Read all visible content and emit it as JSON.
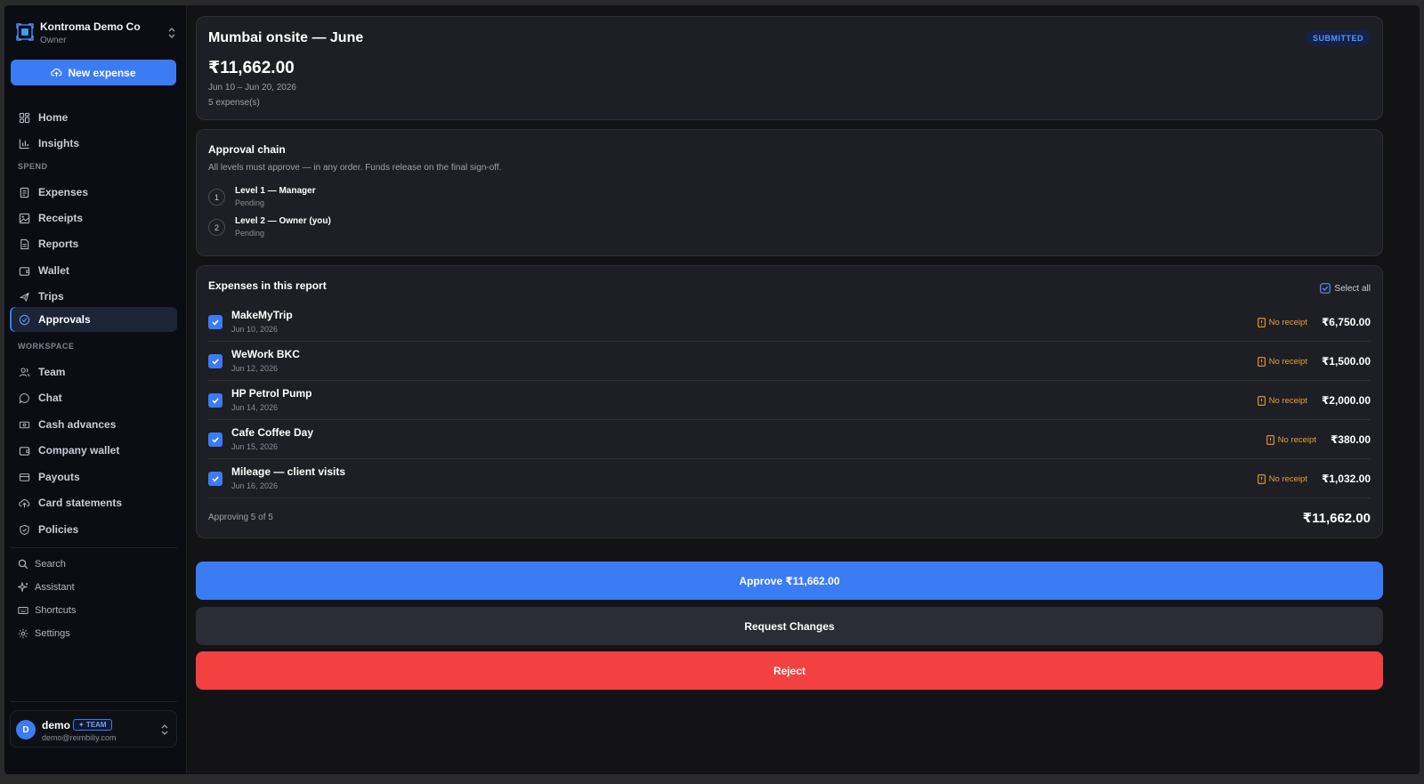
{
  "sidebar": {
    "org_name": "Kontroma Demo Co",
    "org_role": "Owner",
    "new_expense_label": "New expense",
    "nav_top": [
      {
        "label": "Home",
        "icon": "grid-icon"
      },
      {
        "label": "Insights",
        "icon": "bar-chart-icon"
      }
    ],
    "spend_section": "SPEND",
    "nav_spend": [
      {
        "label": "Expenses",
        "icon": "document-icon"
      },
      {
        "label": "Receipts",
        "icon": "image-icon"
      },
      {
        "label": "Reports",
        "icon": "report-icon"
      },
      {
        "label": "Wallet",
        "icon": "wallet-icon"
      },
      {
        "label": "Trips",
        "icon": "plane-icon"
      },
      {
        "label": "Approvals",
        "icon": "check-circle-icon",
        "active": true
      }
    ],
    "workspace_section": "WORKSPACE",
    "nav_workspace": [
      {
        "label": "Team",
        "icon": "users-icon"
      },
      {
        "label": "Chat",
        "icon": "chat-icon"
      },
      {
        "label": "Cash advances",
        "icon": "cash-icon"
      },
      {
        "label": "Company wallet",
        "icon": "wallet-icon"
      },
      {
        "label": "Payouts",
        "icon": "card-icon"
      },
      {
        "label": "Card statements",
        "icon": "cloud-upload-icon"
      },
      {
        "label": "Policies",
        "icon": "shield-icon"
      }
    ],
    "utilities": [
      {
        "label": "Search",
        "icon": "search-icon"
      },
      {
        "label": "Assistant",
        "icon": "sparkle-icon"
      },
      {
        "label": "Shortcuts",
        "icon": "keyboard-icon"
      },
      {
        "label": "Settings",
        "icon": "gear-icon"
      }
    ],
    "user": {
      "initial": "D",
      "name": "demo",
      "badge": "✦ TEAM",
      "email": "demo@reimbiliy.com"
    }
  },
  "report": {
    "title": "Mumbai onsite — June",
    "status": "SUBMITTED",
    "amount": "₹11,662.00",
    "dates": "Jun 10 – Jun 20, 2026",
    "count": "5 expense(s)"
  },
  "approval_chain": {
    "title": "Approval chain",
    "subtitle": "All levels must approve — in any order. Funds release on the final sign-off.",
    "levels": [
      {
        "num": "1",
        "name": "Level 1 — Manager",
        "status": "Pending"
      },
      {
        "num": "2",
        "name": "Level 2 — Owner (you)",
        "status": "Pending"
      }
    ]
  },
  "expenses": {
    "title": "Expenses in this report",
    "select_all": "Select all",
    "items": [
      {
        "name": "MakeMyTrip",
        "date": "Jun 10, 2026",
        "receipt": "No receipt",
        "amount": "₹6,750.00",
        "checked": true
      },
      {
        "name": "WeWork BKC",
        "date": "Jun 12, 2026",
        "receipt": "No receipt",
        "amount": "₹1,500.00",
        "checked": true
      },
      {
        "name": "HP Petrol Pump",
        "date": "Jun 14, 2026",
        "receipt": "No receipt",
        "amount": "₹2,000.00",
        "checked": true
      },
      {
        "name": "Cafe Coffee Day",
        "date": "Jun 15, 2026",
        "receipt": "No receipt",
        "amount": "₹380.00",
        "checked": true
      },
      {
        "name": "Mileage — client visits",
        "date": "Jun 16, 2026",
        "receipt": "No receipt",
        "amount": "₹1,032.00",
        "checked": true
      }
    ],
    "approving_text": "Approving 5 of 5",
    "total": "₹11,662.00"
  },
  "actions": {
    "approve": "Approve ₹11,662.00",
    "request_changes": "Request Changes",
    "reject": "Reject"
  },
  "colors": {
    "accent": "#3b7cf5",
    "reject": "#f34141",
    "warning": "#e8a03a"
  }
}
